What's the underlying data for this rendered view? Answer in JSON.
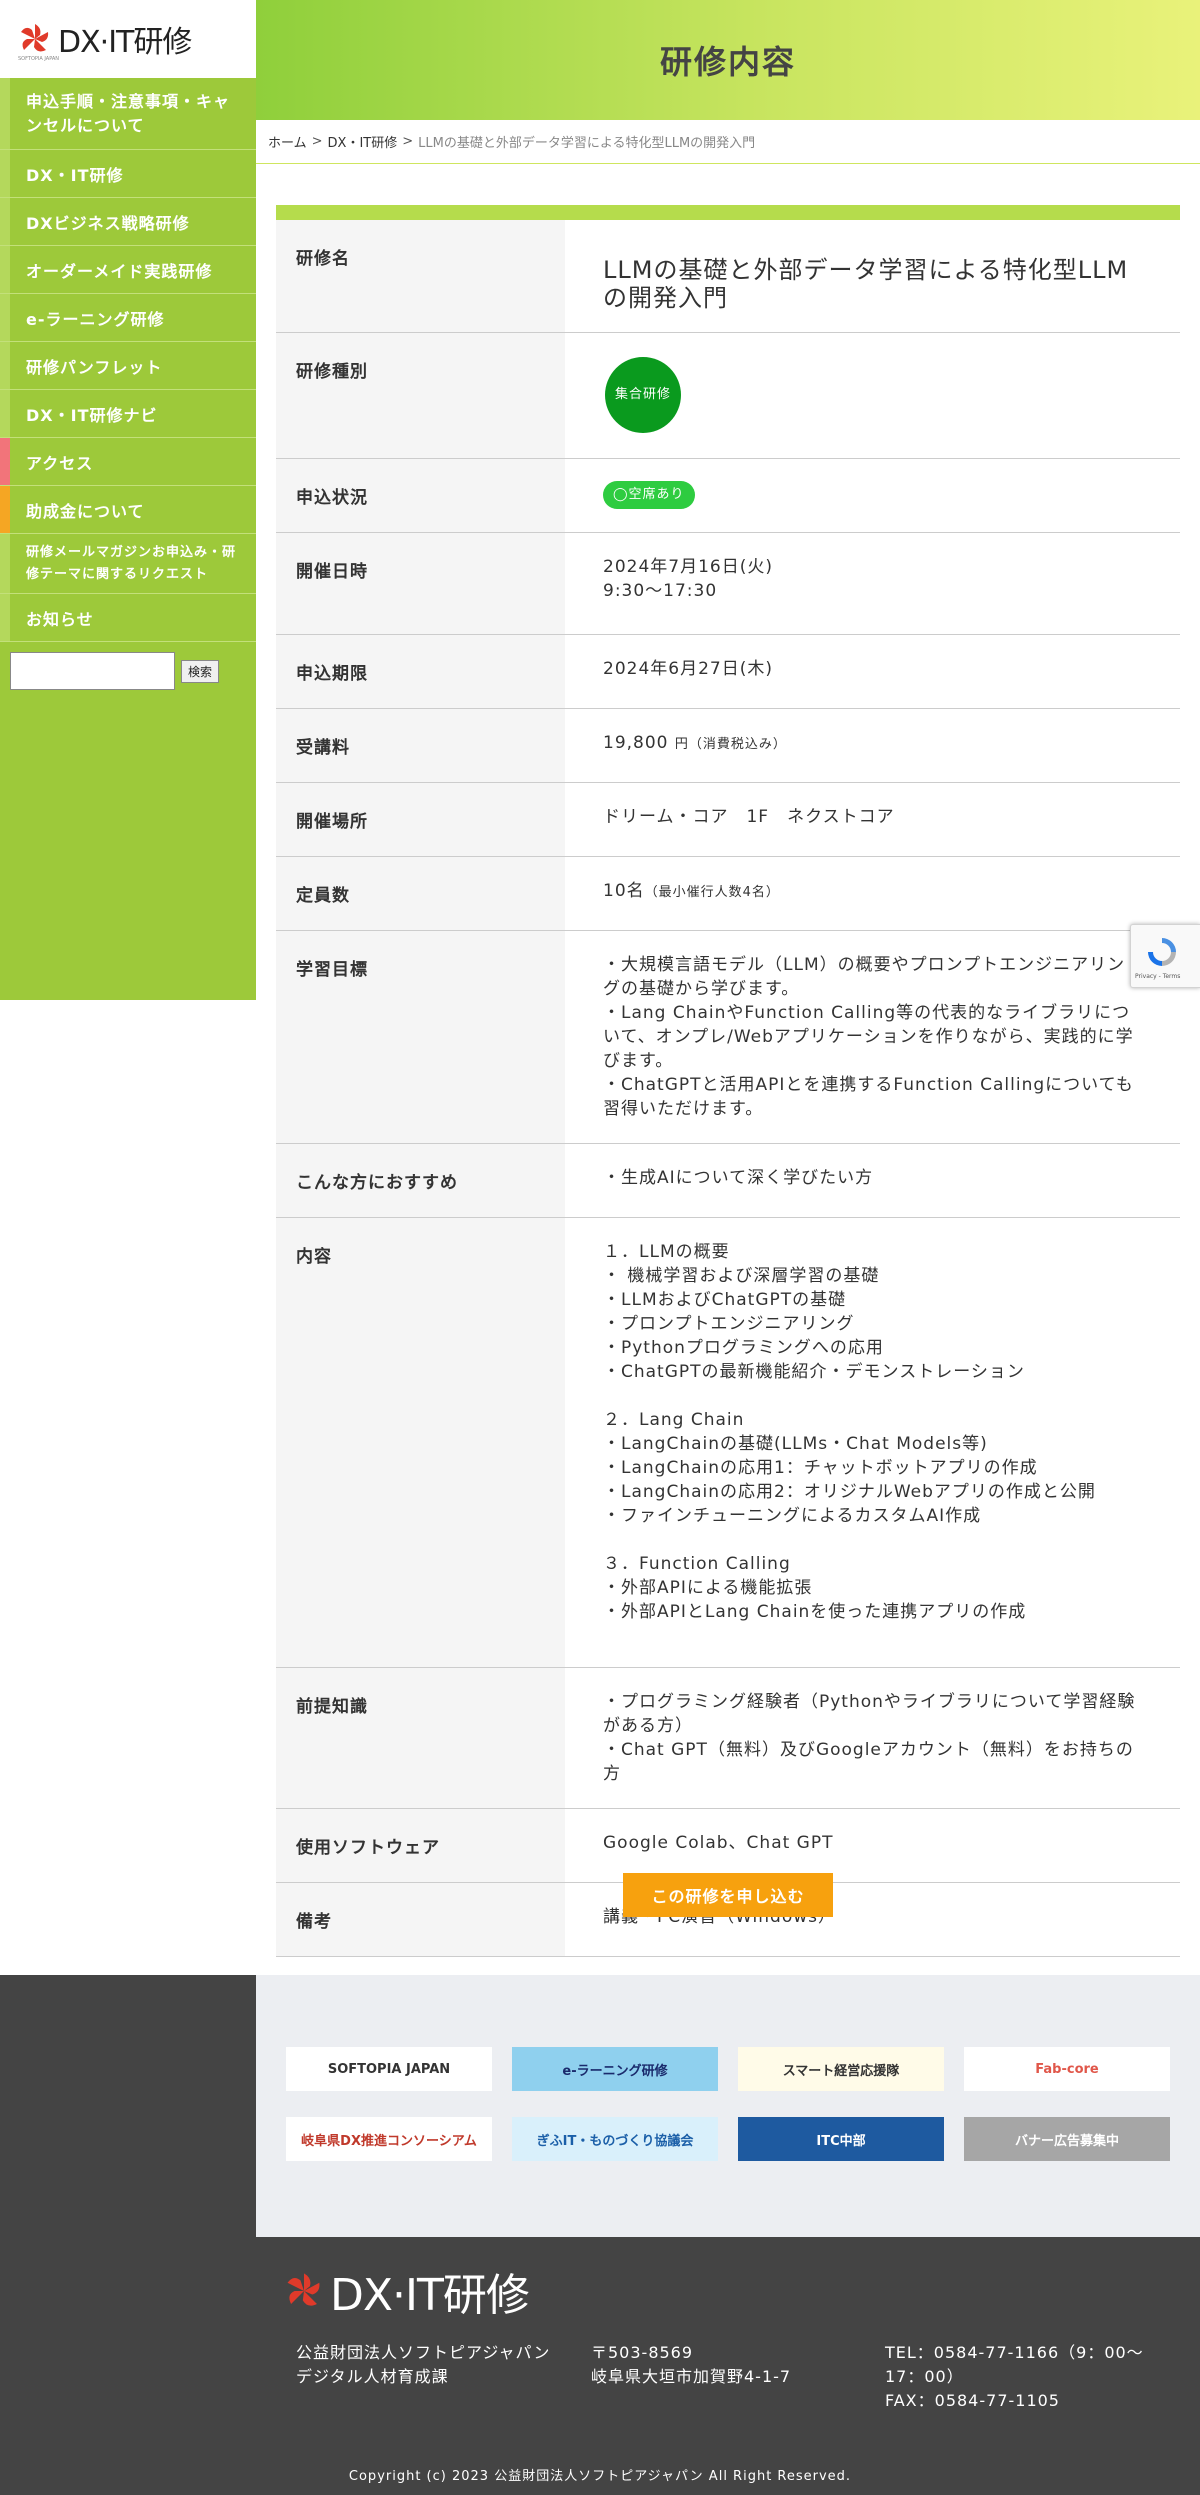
{
  "brand": {
    "name": "DX·IT研修",
    "sub": "SOFTOPIA JAPAN"
  },
  "sidebar": {
    "items": [
      {
        "label": "申込手順・注意事項・キャンセルについて"
      },
      {
        "label": "DX・IT研修"
      },
      {
        "label": "DXビジネス戦略研修"
      },
      {
        "label": "オーダーメイド実践研修"
      },
      {
        "label": "e-ラーニング研修"
      },
      {
        "label": "研修パンフレット"
      },
      {
        "label": "DX・IT研修ナビ"
      },
      {
        "label": "アクセス"
      },
      {
        "label": "助成金について"
      },
      {
        "label": "研修メールマガジンお申込み・研修テーマに関するリクエスト"
      },
      {
        "label": "お知らせ"
      }
    ],
    "search_button": "検索"
  },
  "header": {
    "title": "研修内容"
  },
  "breadcrumb": {
    "home": "ホーム",
    "sep": ">",
    "category": "DX・IT研修",
    "current": "LLMの基礎と外部データ学習による特化型LLMの開発入門"
  },
  "table": {
    "rows": {
      "name": {
        "label": "研修名",
        "value": "LLMの基礎と外部データ学習による特化型LLMの開発入門"
      },
      "type": {
        "label": "研修種別",
        "value": "集合研修"
      },
      "status": {
        "label": "申込状況",
        "value": "◯空席あり"
      },
      "date": {
        "label": "開催日時",
        "value": "2024年7月16日(火)\n9:30〜17:30"
      },
      "deadline": {
        "label": "申込期限",
        "value": "2024年6月27日(木)"
      },
      "fee": {
        "label": "受講料",
        "value": "19,800",
        "unit": "円",
        "note": "（消費税込み）"
      },
      "venue": {
        "label": "開催場所",
        "value": "ドリーム・コア　1F　ネクストコア"
      },
      "capacity": {
        "label": "定員数",
        "value": "10名",
        "note": "（最小催行人数4名）"
      },
      "goal": {
        "label": "学習目標",
        "value": "・大規模言語モデル（LLM）の概要やプロンプトエンジニアリングの基礎から学びます。\n・Lang ChainやFunction Calling等の代表的なライブラリについて、オンプレ/Webアプリケーションを作りながら、実践的に学びます。\n・ChatGPTと活用APIとを連携するFunction Callingについても習得いただけます。"
      },
      "target": {
        "label": "こんな方におすすめ",
        "value": "・生成AIについて深く学びたい方"
      },
      "contents": {
        "label": "内容",
        "value": "１．LLMの概要\n・ 機械学習および深層学習の基礎\n・LLMおよびChatGPTの基礎\n・プロンプトエンジニアリング\n・Pythonプログラミングへの応用\n・ChatGPTの最新機能紹介・デモンストレーション\n\n２．Lang Chain\n・LangChainの基礎(LLMs・Chat Models等)\n・LangChainの応用1：チャットボットアプリの作成\n・LangChainの応用2：オリジナルWebアプリの作成と公開\n・ファインチューニングによるカスタムAI作成\n\n３．Function Calling\n・外部APIによる機能拡張\n・外部APIとLang Chainを使った連携アプリの作成"
      },
      "prereq": {
        "label": "前提知識",
        "value": "・プログラミング経験者（Pythonやライブラリについて学習経験がある方）\n・Chat GPT（無料）及びGoogleアカウント（無料）をお持ちの方"
      },
      "software": {
        "label": "使用ソフトウェア",
        "value": "Google Colab、Chat GPT"
      },
      "remarks": {
        "label": "備考",
        "value": "講義・PC演習（Windows）"
      }
    }
  },
  "apply_button": "この研修を申し込む",
  "recaptcha": {
    "label": "Privacy - Terms"
  },
  "banners": [
    {
      "label": "SOFTOPIA JAPAN",
      "bg": "#ffffff",
      "color": "#333333"
    },
    {
      "label": "e-ラーニング研修",
      "bg": "#8fd0ee",
      "color": "#1a2a6c"
    },
    {
      "label": "スマート経営応援隊",
      "bg": "#fffbe8",
      "color": "#333333"
    },
    {
      "label": "Fab-core",
      "bg": "#ffffff",
      "color": "#e0574a"
    },
    {
      "label": "岐阜県DX推進コンソーシアム",
      "bg": "#ffffff",
      "color": "#c0392b"
    },
    {
      "label": "ぎふIT・ものづくり協議会",
      "bg": "#d9f0fb",
      "color": "#1b5fa8"
    },
    {
      "label": "ITC中部",
      "bg": "#1e5aa0",
      "color": "#ffffff"
    },
    {
      "label": "バナー広告募集中",
      "bg": "#a6a6a6",
      "color": "#ffffff"
    }
  ],
  "footer": {
    "org": "公益財団法人ソフトピアジャパン\nデジタル人材育成課",
    "address": "〒503-8569\n岐阜県大垣市加賀野4-1-7",
    "contact": "TEL：0584-77-1166（9：00〜17：00）\nFAX：0584-77-1105",
    "copyright": "Copyright (c) 2023 公益財団法人ソフトピアジャパン All Right Reserved."
  },
  "colors": {
    "sidebar": "#9dc93a",
    "accent": "#b5dc4c",
    "button": "#f7a10e",
    "status": "#2ecc40",
    "type": "#0a9a1e",
    "footer": "#444444"
  }
}
